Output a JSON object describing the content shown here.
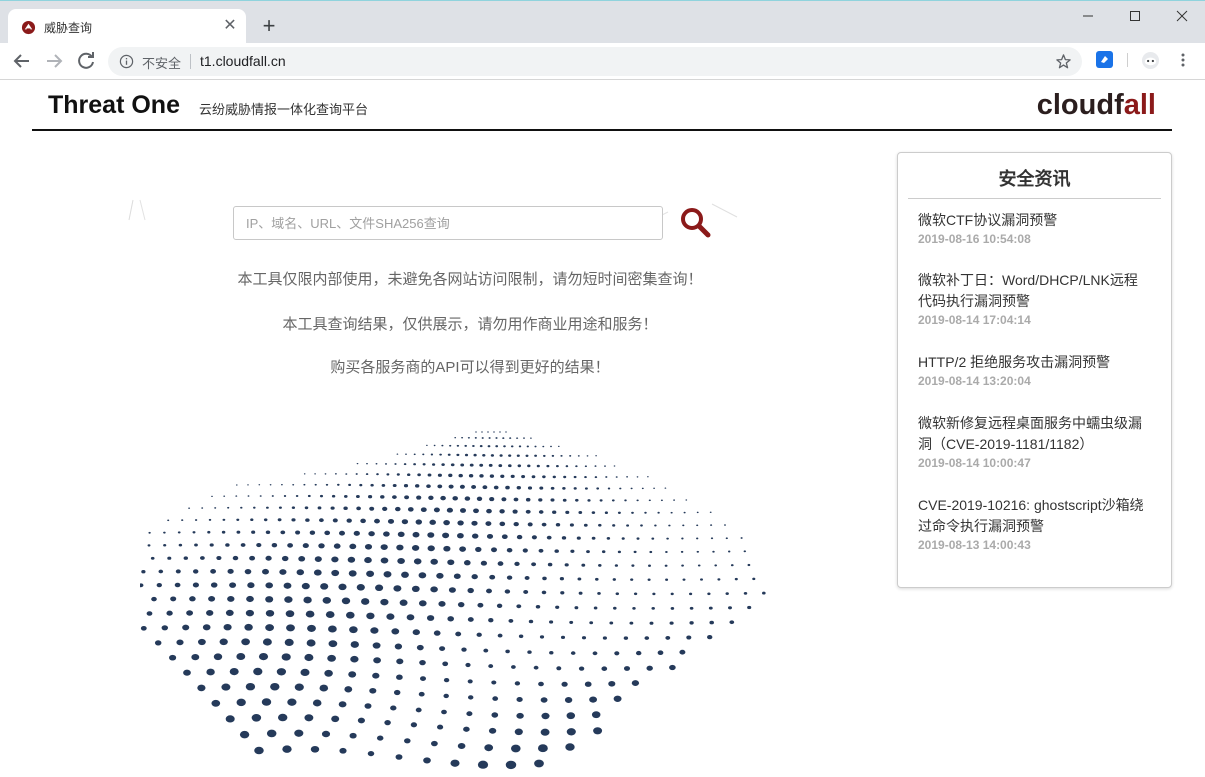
{
  "browser": {
    "tab_title": "威胁查询",
    "insecure_label": "不安全",
    "url": "t1.cloudfall.cn"
  },
  "header": {
    "title": "Threat One",
    "subtitle": "云纷威胁情报一体化查询平台",
    "logo_main": "cloudf",
    "logo_accent": "all"
  },
  "search": {
    "placeholder": "IP、域名、URL、文件SHA256查询",
    "value": ""
  },
  "notices": [
    "本工具仅限内部使用，未避免各网站访问限制，请勿短时间密集查询！",
    "本工具查询结果，仅供展示，请勿用作商业用途和服务！",
    "购买各服务商的API可以得到更好的结果！"
  ],
  "news": {
    "title": "安全资讯",
    "items": [
      {
        "headline": "微软CTF协议漏洞预警",
        "date": "2019-08-16 10:54:08"
      },
      {
        "headline": "微软补丁日：Word/DHCP/LNK远程代码执行漏洞预警",
        "date": "2019-08-14 17:04:14"
      },
      {
        "headline": "HTTP/2 拒绝服务攻击漏洞预警",
        "date": "2019-08-14 13:20:04"
      },
      {
        "headline": "微软新修复远程桌面服务中蠕虫级漏洞（CVE-2019-1181/1182）",
        "date": "2019-08-14 10:00:47"
      },
      {
        "headline": "CVE-2019-10216: ghostscript沙箱绕过命令执行漏洞预警",
        "date": "2019-08-13 14:00:43"
      }
    ]
  },
  "colors": {
    "accent": "#8b1a1a",
    "dots": "#253a5a",
    "text": "#333333"
  }
}
